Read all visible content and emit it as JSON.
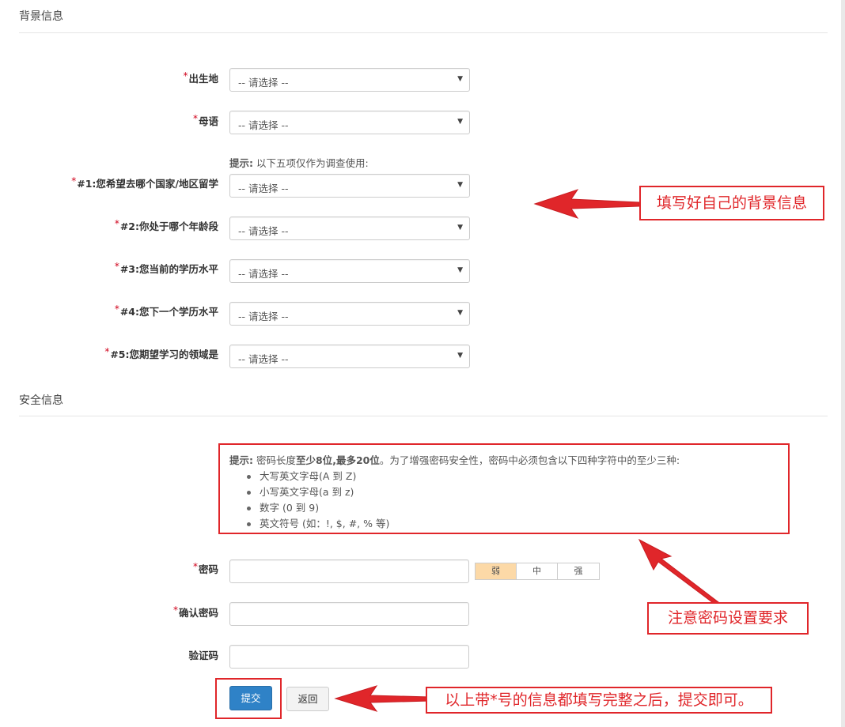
{
  "background_section": {
    "title": "背景信息",
    "fields": [
      {
        "label": "出生地",
        "required": true,
        "value": "-- 请选择 --"
      },
      {
        "label": "母语",
        "required": true,
        "value": "-- 请选择 --"
      },
      {
        "label": "#1:您希望去哪个国家/地区留学",
        "required": true,
        "value": "-- 请选择 --"
      },
      {
        "label": "#2:你处于哪个年龄段",
        "required": true,
        "value": "-- 请选择 --"
      },
      {
        "label": "#3:您当前的学历水平",
        "required": true,
        "value": "-- 请选择 --"
      },
      {
        "label": "#4:您下一个学历水平",
        "required": true,
        "value": "-- 请选择 --"
      },
      {
        "label": "#5:您期望学习的领域是",
        "required": true,
        "value": "-- 请选择 --"
      }
    ],
    "hint_bold": "提示:",
    "hint_text": " 以下五项仅作为调查使用:"
  },
  "security_section": {
    "title": "安全信息",
    "pw_hint": {
      "bold_prefix": "提示:",
      "text1": " 密码长度",
      "bold1": "至少8位",
      "sep": ",",
      "bold2": "最多20位",
      "text2": "。为了增强密码安全性，密码中必须包含以下四种字符中的至少三种:",
      "items": [
        "大写英文字母(A 到 Z)",
        "小写英文字母(a 到 z)",
        "数字 (0 到 9)",
        "英文符号 (如：!, $, #, % 等)"
      ]
    },
    "password_label": "密码",
    "confirm_label": "确认密码",
    "captcha_label": "验证码",
    "strength": {
      "weak": "弱",
      "medium": "中",
      "strong": "强",
      "active_color": "#fcd9a7"
    }
  },
  "buttons": {
    "submit": "提交",
    "back": "返回"
  },
  "annotations": {
    "callout_background": "填写好自己的背景信息",
    "callout_password": "注意密码设置要求",
    "callout_submit": "以上带*号的信息都填写完整之后，提交即可。",
    "color": "#e0262a"
  },
  "required_mark": "*",
  "caret": "▼",
  "accent_color": "#2f82c7"
}
